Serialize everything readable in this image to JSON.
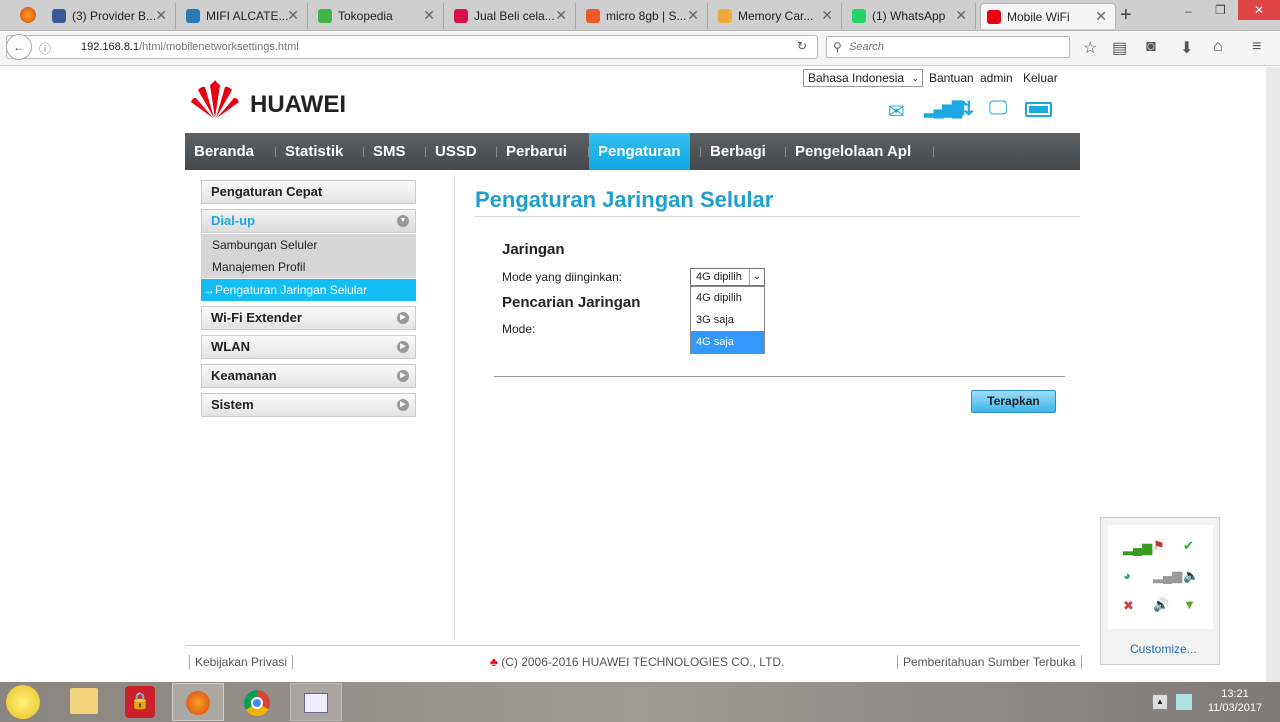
{
  "browser": {
    "tabs": [
      {
        "label": "(3) Provider B...",
        "color": "#3b5998"
      },
      {
        "label": "MIFI ALCATE...",
        "color": "#2a7ab8"
      },
      {
        "label": "Tokopedia",
        "color": "#42b549"
      },
      {
        "label": "Jual Beli cela...",
        "color": "#d71149"
      },
      {
        "label": "micro 8gb | S...",
        "color": "#f05a28"
      },
      {
        "label": "Memory Car...",
        "color": "#f2a93b"
      },
      {
        "label": "(1) WhatsApp",
        "color": "#25d366"
      },
      {
        "label": "Mobile WiFi",
        "color": "#e60012"
      }
    ],
    "url_host": "192.168.8.1",
    "url_path": "/html/mobilenetworksettings.html",
    "search_placeholder": "Search"
  },
  "header": {
    "brand": "HUAWEI",
    "language": "Bahasa Indonesia",
    "links": [
      "Bantuan",
      "admin",
      "Keluar"
    ]
  },
  "nav": [
    "Beranda",
    "Statistik",
    "SMS",
    "USSD",
    "Perbarui",
    "Pengaturan",
    "Berbagi",
    "Pengelolaan Apl"
  ],
  "nav_active": "Pengaturan",
  "sidebar": {
    "quick": "Pengaturan Cepat",
    "dialup": "Dial-up",
    "sub": [
      "Sambungan Seluler",
      "Manajemen Profil",
      "→Pengaturan Jaringan Selular"
    ],
    "groups": [
      "Wi-Fi Extender",
      "WLAN",
      "Keamanan",
      "Sistem"
    ]
  },
  "main": {
    "title": "Pengaturan Jaringan Selular",
    "section1": "Jaringan",
    "mode_label": "Mode yang diinginkan:",
    "mode_value": "4G dipilih",
    "mode_options": [
      "4G dipilih",
      "3G saja",
      "4G saja"
    ],
    "mode_highlighted": "4G saja",
    "section2": "Pencarian Jaringan",
    "search_mode_label": "Mode:",
    "apply": "Terapkan"
  },
  "footer": {
    "privacy": "Kebijakan Privasi",
    "copyright": "(C) 2006-2016 HUAWEI TECHNOLOGIES CO., LTD.",
    "opensource": "Pemberitahuan Sumber Terbuka"
  },
  "tray": {
    "customize": "Customize...",
    "time": "13:21",
    "date": "11/03/2017"
  },
  "colors": {
    "accent": "#1aa9e0",
    "nav": "#4f5456",
    "title": "#1e9fd0"
  }
}
